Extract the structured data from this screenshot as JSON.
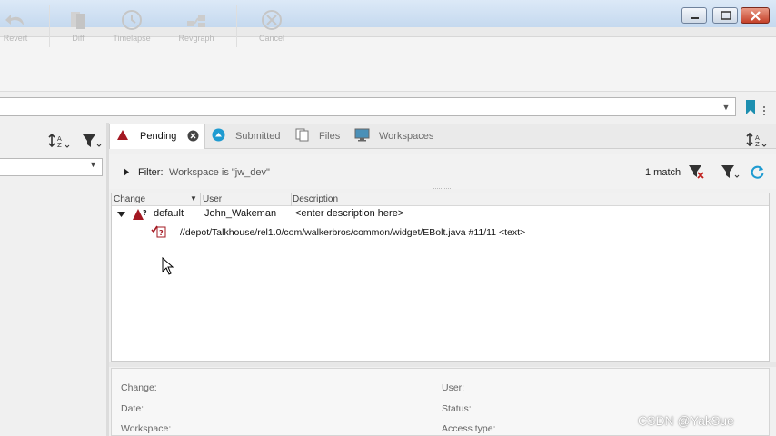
{
  "toolbar": {
    "revert_label": "Revert",
    "diff_label": "Diff",
    "timelapse_label": "Timelapse",
    "revgraph_label": "Revgraph",
    "cancel_label": "Cancel"
  },
  "tabs": [
    {
      "label": "Pending"
    },
    {
      "label": "Submitted"
    },
    {
      "label": "Files"
    },
    {
      "label": "Workspaces"
    }
  ],
  "filter": {
    "label": "Filter:",
    "text": "Workspace is \"jw_dev\"",
    "match_count": "1 match"
  },
  "table": {
    "columns": [
      "Change",
      "User",
      "Description"
    ],
    "changelist": {
      "change": "default",
      "user": "John_Wakeman",
      "description": "<enter description here>"
    },
    "file_row": "//depot/Talkhouse/rel1.0/com/walkerbros/common/widget/EBolt.java #11/11 <text>"
  },
  "details": {
    "change_label": "Change:",
    "date_label": "Date:",
    "workspace_label": "Workspace:",
    "user_label": "User:",
    "status_label": "Status:",
    "access_label": "Access type:"
  },
  "watermark": "CSDN @YakSue",
  "colors": {
    "accent_red": "#a31822",
    "accent_teal": "#1f9bd1",
    "bookmark_teal": "#1d8fb0"
  }
}
